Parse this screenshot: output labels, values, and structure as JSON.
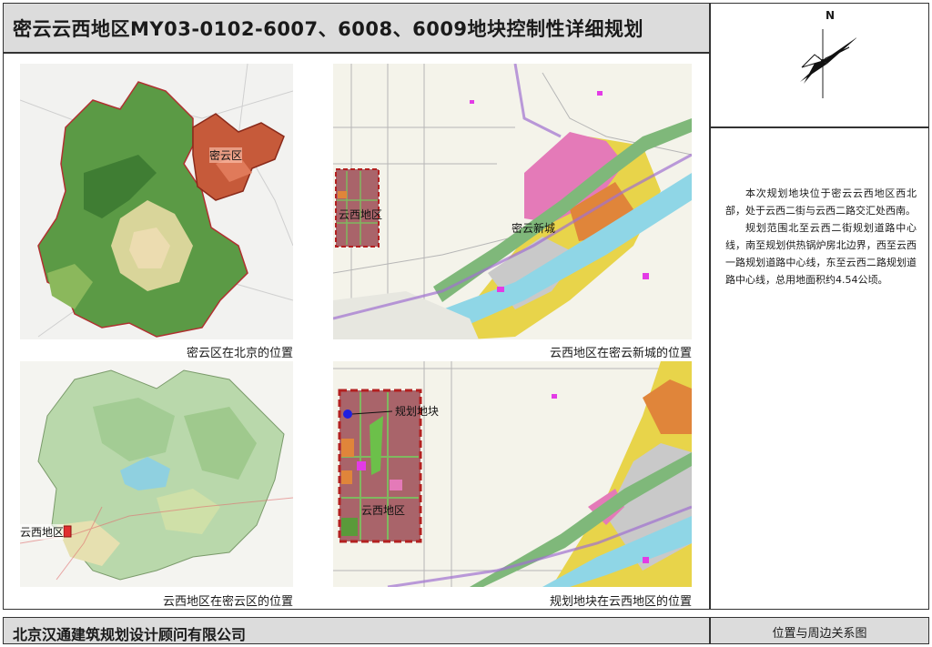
{
  "header": {
    "title": "密云云西地区MY03-0102-6007、6008、6009地块控制性详细规划"
  },
  "compass": {
    "north_label": "N"
  },
  "description": {
    "paragraphs": [
      "本次规划地块位于密云云西地区西北部，处于云西二街与云西二路交汇处西南。",
      "规划范围北至云西二街规划道路中心线，南至规划供热锅炉房北边界，西至云西一路规划道路中心线，东至云西二路规划道路中心线，总用地面积约4.54公顷。"
    ]
  },
  "maps": {
    "beijing": {
      "label": "密云区",
      "caption": "密云区在北京的位置"
    },
    "new_town": {
      "label_west": "云西地区",
      "label_town": "密云新城",
      "caption": "云西地区在密云新城的位置"
    },
    "miyun_district": {
      "label": "云西地区",
      "caption": "云西地区在密云区的位置"
    },
    "plot": {
      "label_plot": "规划地块",
      "label_area": "云西地区",
      "caption": "规划地块在云西地区的位置"
    }
  },
  "footer": {
    "company": "北京汉通建筑规划设计顾问有限公司",
    "sheet_title": "位置与周边关系图"
  }
}
